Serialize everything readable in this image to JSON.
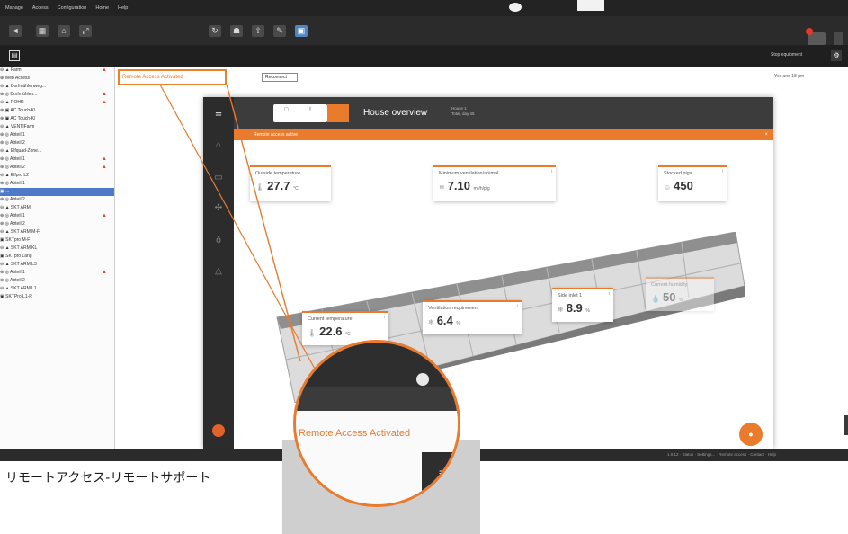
{
  "menubar": {
    "items": [
      "Manage",
      "Access",
      "Configuration",
      "Home",
      "Help"
    ]
  },
  "toolbar": {
    "left_icons": [
      "back-icon",
      "grid-icon",
      "building-icon",
      "expand-icon"
    ],
    "center_icons": [
      "refresh-icon",
      "network-icon",
      "export-icon",
      "tools-icon",
      "screen-icon"
    ]
  },
  "subbar": {
    "left_icon": "panel-icon",
    "right_label": "Stop equipment",
    "right_icon": "settings-icon"
  },
  "tree": {
    "items": [
      {
        "label": "⊖ ▲ Farm",
        "warn": true
      },
      {
        "label": "   ⊕ Web Access",
        "warn": false
      },
      {
        "label": "⊖ ▲ Dorfmühlenweg...",
        "warn": false
      },
      {
        "label": "   ⊕ ◎ Dorfmühlen...",
        "warn": true
      },
      {
        "label": "⊖ ▲ ROHR",
        "warn": true
      },
      {
        "label": "   ⊕ ▣ AC Touch-Kl",
        "warn": false
      },
      {
        "label": "   ⊕ ▣ AC Touch-Kl",
        "warn": false
      },
      {
        "label": "⊖ ▲ VENTIFarm",
        "warn": false
      },
      {
        "label": "   ⊕ ◎ Abteil 1",
        "warn": false
      },
      {
        "label": "   ⊕ ◎ Abteil 2",
        "warn": false
      },
      {
        "label": "⊖ ▲ Elfquad-Zone...",
        "warn": false
      },
      {
        "label": "   ⊕ ◎ Abteil 1",
        "warn": true
      },
      {
        "label": "   ⊕ ◎ Abteil 2",
        "warn": true
      },
      {
        "label": "⊖ ▲ Elfpro L2",
        "warn": false
      },
      {
        "label": "   ⊕ ◎ Abteil 1",
        "warn": false
      },
      {
        "label": "        ▣ ...",
        "warn": false,
        "selected": true
      },
      {
        "label": "   ⊕ ◎ Abteil 2",
        "warn": false
      },
      {
        "label": "⊖ ▲ SKT ARM",
        "warn": false
      },
      {
        "label": "   ⊕ ◎ Abteil 1",
        "warn": true
      },
      {
        "label": "   ⊕ ◎ Abteil 2",
        "warn": false
      },
      {
        "label": "⊖ ▲ SKT ARM M-F",
        "warn": false
      },
      {
        "label": "   ▣ SKTpro M-F",
        "warn": false
      },
      {
        "label": "⊖ ▲ SKT ARM KL",
        "warn": false
      },
      {
        "label": "   ▣ SKTpro Lang",
        "warn": false
      },
      {
        "label": "⊖ ▲ SKT ARM L3",
        "warn": false
      },
      {
        "label": "   ⊕ ◎ Abteil 1",
        "warn": true
      },
      {
        "label": "   ⊕ ◎ Abteil 2",
        "warn": false
      },
      {
        "label": "⊖ ▲ SKT ARM L1",
        "warn": false
      },
      {
        "label": "   ▣ SKTPro L1-R",
        "warn": false
      }
    ]
  },
  "main": {
    "remote_label_small": "Remote Access Activated",
    "reconnect_label": "Reconnect",
    "right_header": "Yes and 18 pm"
  },
  "device": {
    "menu_icon": "menu-icon",
    "tab_labels": [
      "□",
      "!"
    ],
    "title": "House overview",
    "subtitle_line1": "House 1",
    "subtitle_line2": "Total, day 45",
    "banner": "Remote access active",
    "banner_close": "×",
    "side_icons": [
      "home-icon",
      "folder-icon",
      "fan-icon",
      "thermometer-icon",
      "bell-icon"
    ],
    "cards": {
      "outside": {
        "label": "Outside temperature",
        "value": "27.7",
        "unit": "°C",
        "icon": "🌡"
      },
      "min_vent": {
        "label": "Minimum ventilation/animal",
        "value": "7.10",
        "unit": "m³/h/pig",
        "icon": "❄"
      },
      "stocked": {
        "label": "Stocked pigs",
        "value": "450",
        "unit": "",
        "icon": "☺"
      },
      "current_temp": {
        "label": "Current temperature",
        "value": "22.6",
        "unit": "°C",
        "icon": "🌡"
      },
      "vent_req": {
        "label": "Ventilation requirement",
        "value": "6.4",
        "unit": "%",
        "icon": "❄"
      },
      "side_inlet": {
        "label": "Side inlet 1",
        "value": "8.9",
        "unit": "%",
        "icon": "❄"
      },
      "humidity": {
        "label": "Current humidity",
        "value": "50",
        "unit": "%",
        "icon": "💧"
      }
    },
    "fab_icon": "action-icon"
  },
  "zoom": {
    "text": "Remote Access Activated",
    "menu_icon": "≡"
  },
  "bottom": {
    "right_text": "1.0.12 · Status · Settings... · Remote access · Contact · Help"
  },
  "caption": "リモートアクセス-リモートサポート",
  "colors": {
    "accent": "#ea7a2c",
    "dark": "#2c2c2c",
    "selected": "#4d79c8"
  }
}
